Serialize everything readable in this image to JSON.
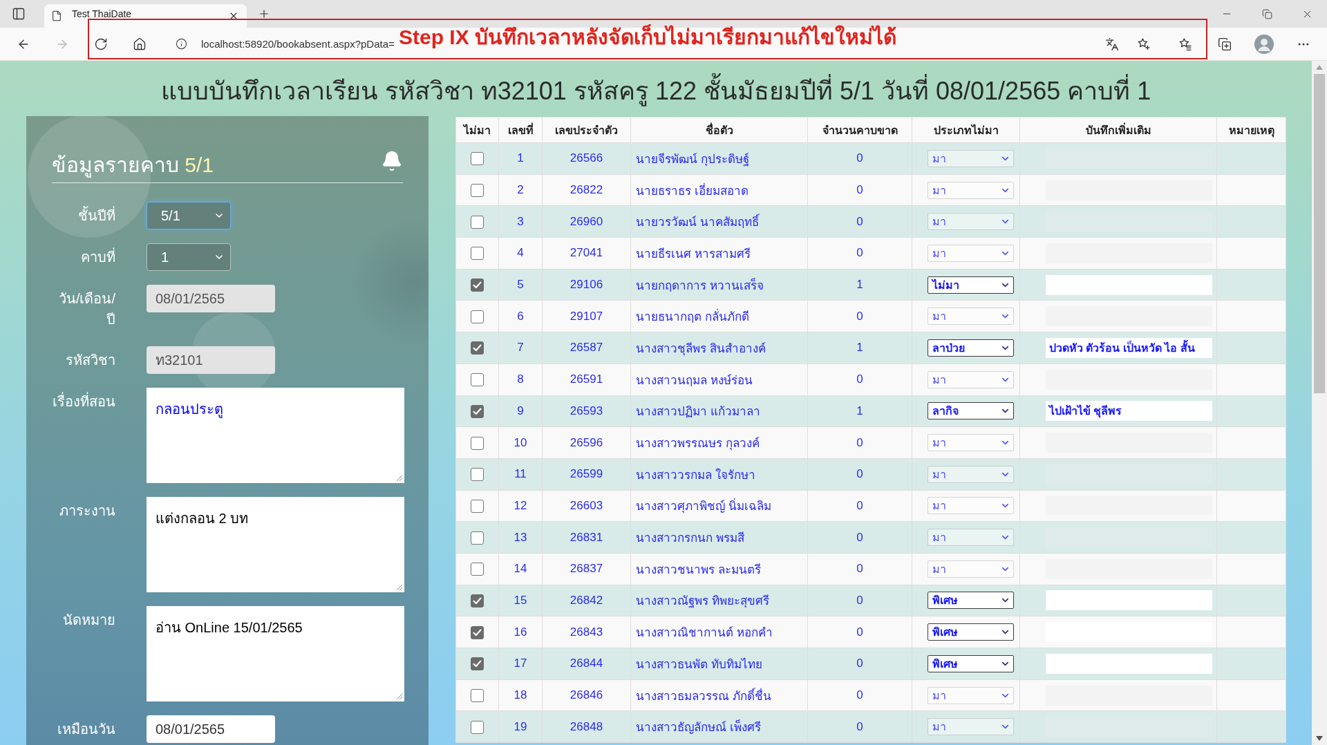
{
  "browser": {
    "tab_title": "Test ThaiDate",
    "url": "localhost:58920/bookabsent.aspx?pData="
  },
  "annotation": "Step IX บันทึกเวลาหลังจัดเก็บไม่มาเรียกมาแก้ไขใหม่ได้",
  "page_title": "แบบบันทึกเวลาเรียน รหัสวิชา ท32101 รหัสครู 122 ชั้นมัธยมปีที่ 5/1 วันที่ 08/01/2565 คาบที่ 1",
  "period_panel": {
    "heading": "ข้อมูลรายคาบ",
    "heading_class": "5/1",
    "fields": [
      {
        "kind": "select",
        "label": "ชั้นปีที่",
        "value": "5/1",
        "focused": true
      },
      {
        "kind": "select",
        "label": "คาบที่",
        "value": "1",
        "focused": false
      },
      {
        "kind": "input",
        "label": "วัน/เดือน/ปี",
        "value": "08/01/2565",
        "disabled": true
      },
      {
        "kind": "input",
        "label": "รหัสวิชา",
        "value": "ท32101",
        "disabled": true
      },
      {
        "kind": "textarea",
        "label": "เรื่องที่สอน",
        "value": "กลอนประตู",
        "color": "#0000ff"
      },
      {
        "kind": "textarea",
        "label": "ภาระงาน",
        "value": "แต่งกลอน 2 บท",
        "color": "#000000"
      },
      {
        "kind": "textarea",
        "label": "นัดหมาย",
        "value": "อ่าน OnLine 15/01/2565",
        "color": "#000000"
      },
      {
        "kind": "input",
        "label": "เหมือนวัน",
        "value": "08/01/2565",
        "disabled": false
      }
    ]
  },
  "table": {
    "columns": [
      "ไม่มา",
      "เลขที่",
      "เลขประจำตัว",
      "ชื่อตัว",
      "จำนวนคาบขาด",
      "ประเภทไม่มา",
      "บันทึกเพิ่มเติม",
      "หมายเหตุ"
    ],
    "rows": [
      {
        "absent": false,
        "number": "1",
        "student_id": "26566",
        "name": "นายจีรพัฒน์ กุประดิษฐ์",
        "missed_periods": "0",
        "absence_type": "มา"
      },
      {
        "absent": false,
        "number": "2",
        "student_id": "26822",
        "name": "นายธราธร เอี่ยมสอาด",
        "missed_periods": "0",
        "absence_type": "มา"
      },
      {
        "absent": false,
        "number": "3",
        "student_id": "26960",
        "name": "นายวรวัฒน์ นาคสัมฤทธิ์",
        "missed_periods": "0",
        "absence_type": "มา"
      },
      {
        "absent": false,
        "number": "4",
        "student_id": "27041",
        "name": "นายธีรเนศ หารสามศรี",
        "missed_periods": "0",
        "absence_type": "มา"
      },
      {
        "absent": true,
        "number": "5",
        "student_id": "29106",
        "name": "นายกฤดาการ หวานเสร็จ",
        "missed_periods": "1",
        "absence_type": "ไม่มา"
      },
      {
        "absent": false,
        "number": "6",
        "student_id": "29107",
        "name": "นายธนากฤต กลั่นภักดี",
        "missed_periods": "0",
        "absence_type": "มา"
      },
      {
        "absent": true,
        "number": "7",
        "student_id": "26587",
        "name": "นางสาวชุลีพร สินสำอางค์",
        "missed_periods": "1",
        "absence_type": "ลาป่วย",
        "note": "ปวดหัว ตัวร้อน เป็นหวัด ไอ สั้น"
      },
      {
        "absent": false,
        "number": "8",
        "student_id": "26591",
        "name": "นางสาวนฤมล หงษ์ร่อน",
        "missed_periods": "0",
        "absence_type": "มา"
      },
      {
        "absent": true,
        "number": "9",
        "student_id": "26593",
        "name": "นางสาวปฏิมา แก้วมาลา",
        "missed_periods": "1",
        "absence_type": "ลากิจ",
        "note": "ไปเฝ้าไข้ ชุลีพร"
      },
      {
        "absent": false,
        "number": "10",
        "student_id": "26596",
        "name": "นางสาวพรรณษร กุลวงค์",
        "missed_periods": "0",
        "absence_type": "มา"
      },
      {
        "absent": false,
        "number": "11",
        "student_id": "26599",
        "name": "นางสาววรกมล ใจรักษา",
        "missed_periods": "0",
        "absence_type": "มา"
      },
      {
        "absent": false,
        "number": "12",
        "student_id": "26603",
        "name": "นางสาวศุภาพิชญ์ นิ่มเฉลิม",
        "missed_periods": "0",
        "absence_type": "มา"
      },
      {
        "absent": false,
        "number": "13",
        "student_id": "26831",
        "name": "นางสาวกรกนก พรมสี",
        "missed_periods": "0",
        "absence_type": "มา"
      },
      {
        "absent": false,
        "number": "14",
        "student_id": "26837",
        "name": "นางสาวชนาพร ละมนตรี",
        "missed_periods": "0",
        "absence_type": "มา"
      },
      {
        "absent": true,
        "number": "15",
        "student_id": "26842",
        "name": "นางสาวณัฐพร ทิพยะสุขศรี",
        "missed_periods": "0",
        "absence_type": "พิเศษ"
      },
      {
        "absent": true,
        "number": "16",
        "student_id": "26843",
        "name": "นางสาวณิชากานต์ หอกคำ",
        "missed_periods": "0",
        "absence_type": "พิเศษ"
      },
      {
        "absent": true,
        "number": "17",
        "student_id": "26844",
        "name": "นางสาวธนพัต ทับทิมไทย",
        "missed_periods": "0",
        "absence_type": "พิเศษ"
      },
      {
        "absent": false,
        "number": "18",
        "student_id": "26846",
        "name": "นางสาวธมลวรรณ ภักดิ์ชื่น",
        "missed_periods": "0",
        "absence_type": "มา"
      },
      {
        "absent": false,
        "number": "19",
        "student_id": "26848",
        "name": "นางสาวธัญลักษณ์ เพ็งศรี",
        "missed_periods": "0",
        "absence_type": "มา"
      }
    ]
  }
}
